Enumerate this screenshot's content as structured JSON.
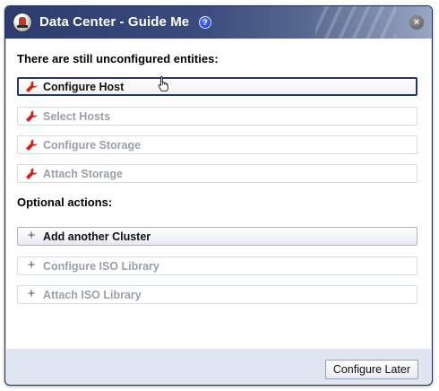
{
  "dialog": {
    "title": "Data Center - Guide Me",
    "help_icon": "question-circle-icon",
    "close_icon": "close-circle-icon",
    "close_glyph": "×",
    "help_glyph": "?"
  },
  "unconfigured": {
    "heading": "There are still unconfigured entities:",
    "actions": [
      {
        "label": "Configure Host",
        "icon": "wrench-icon",
        "state": "focused"
      },
      {
        "label": "Select Hosts",
        "icon": "wrench-icon",
        "state": "disabled"
      },
      {
        "label": "Configure Storage",
        "icon": "wrench-icon",
        "state": "disabled"
      },
      {
        "label": "Attach Storage",
        "icon": "wrench-icon",
        "state": "disabled"
      }
    ]
  },
  "optional": {
    "heading": "Optional actions:",
    "actions": [
      {
        "label": "Add another Cluster",
        "icon": "plus-icon",
        "state": "enabled"
      },
      {
        "label": "Configure ISO Library",
        "icon": "plus-icon",
        "state": "disabled"
      },
      {
        "label": "Attach ISO Library",
        "icon": "plus-icon",
        "state": "disabled"
      }
    ]
  },
  "footer": {
    "configure_later_label": "Configure Later"
  },
  "colors": {
    "titlebar": "#2d3c6e",
    "wrench_red": "#d0241b",
    "disabled_text": "#9aa0aa",
    "focus_border": "#25366b"
  }
}
